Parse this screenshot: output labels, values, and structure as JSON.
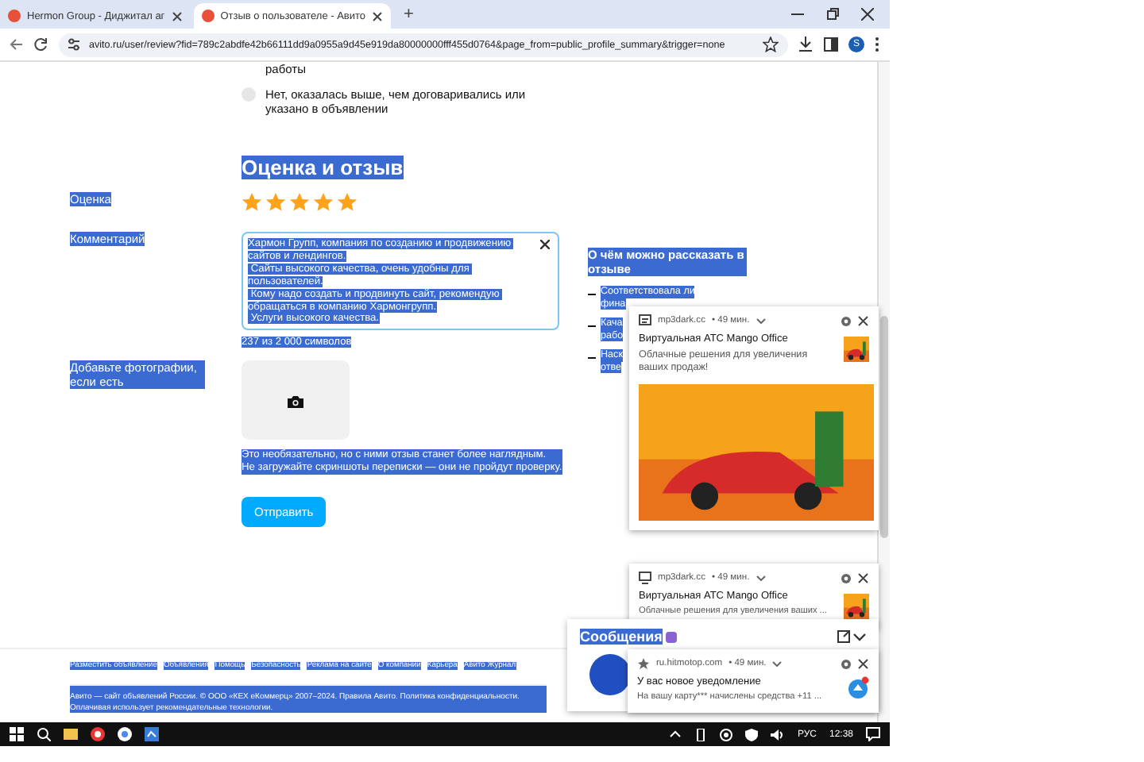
{
  "browser": {
    "tabs": [
      {
        "title": "Hermon Group - Диджитал аг",
        "selected": false
      },
      {
        "title": "Отзыв о пользователе - Авито",
        "selected": true
      }
    ],
    "new_tab": "+",
    "address": "avito.ru/user/review?fid=789c2abdfe42b66111dd9a0955a9d45e919da80000000fff455d0764&page_from=public_profile_summary&trigger=none",
    "profile_initial": "S"
  },
  "form": {
    "text_selected": true,
    "prev_option_tail": "работы",
    "option": {
      "label": "Нет, оказалась выше, чем договаривались или указано в объявлении",
      "selected": false
    },
    "heading": "Оценка и отзыв",
    "rating_label": "Оценка",
    "stars": 5,
    "comment_label": "Комментарий",
    "comment": "Хармон Групп, компания по созданию и продвижению сайтов и лендингов.\n Сайты высокого качества, очень удобны для пользователей.\n Кому надо создать и продвинуть сайт, рекомендую обращаться в компанию Хармонгрупп.\n Услуги высокого качества.",
    "counter": "237 из 2 000 символов",
    "photos_label": "Добавьте фотографии, если есть",
    "photos_hint": "Это необязательно, но с ними отзыв станет более наглядным.\nНе загружайте скриншоты переписки — они не пройдут проверку.",
    "submit": "Отправить"
  },
  "tips": {
    "title": "О чём можно рассказать в отзыве",
    "items": [
      {
        "lines": [
          "Соответствовала ли",
          "фина"
        ]
      },
      {
        "lines": [
          "Кача",
          "рабо"
        ]
      },
      {
        "lines": [
          "Наск",
          "отве"
        ]
      }
    ]
  },
  "footer": {
    "links": [
      "Разместить объявление",
      "Объявления",
      "Помощь",
      "Безопасность",
      "Реклама на сайте",
      "О компании",
      "Карьера",
      "Авито Журнал"
    ],
    "legal": "Авито — сайт объявлений России. © ООО «КЕХ еКоммерц» 2007–2024. Правила Авито. Политика конфиденциальности. Оплачивая использует рекомендательные технологии."
  },
  "notifications": [
    {
      "kind": "ad",
      "source": "mp3dark.cc",
      "time": "• 49 мин.",
      "title": "Виртуальная АТС Mango Office",
      "body": "Облачные решения для увеличения ваших продаж!"
    },
    {
      "kind": "compact",
      "source": "mp3dark.cc",
      "time": "• 49 мин.",
      "title": "Виртуальная АТС Mango Office",
      "body": "Облачные решения для увеличения ваших ..."
    },
    {
      "kind": "message",
      "source": "ru.hitmotop.com",
      "time": "• 49 мин.",
      "title": "У вас новое уведомление",
      "body": "На вашу карту*** начислены средства +11 ..."
    }
  ],
  "messages": {
    "title": "Сообщения"
  },
  "taskbar": {
    "language": "РУС",
    "time": "12:38"
  }
}
